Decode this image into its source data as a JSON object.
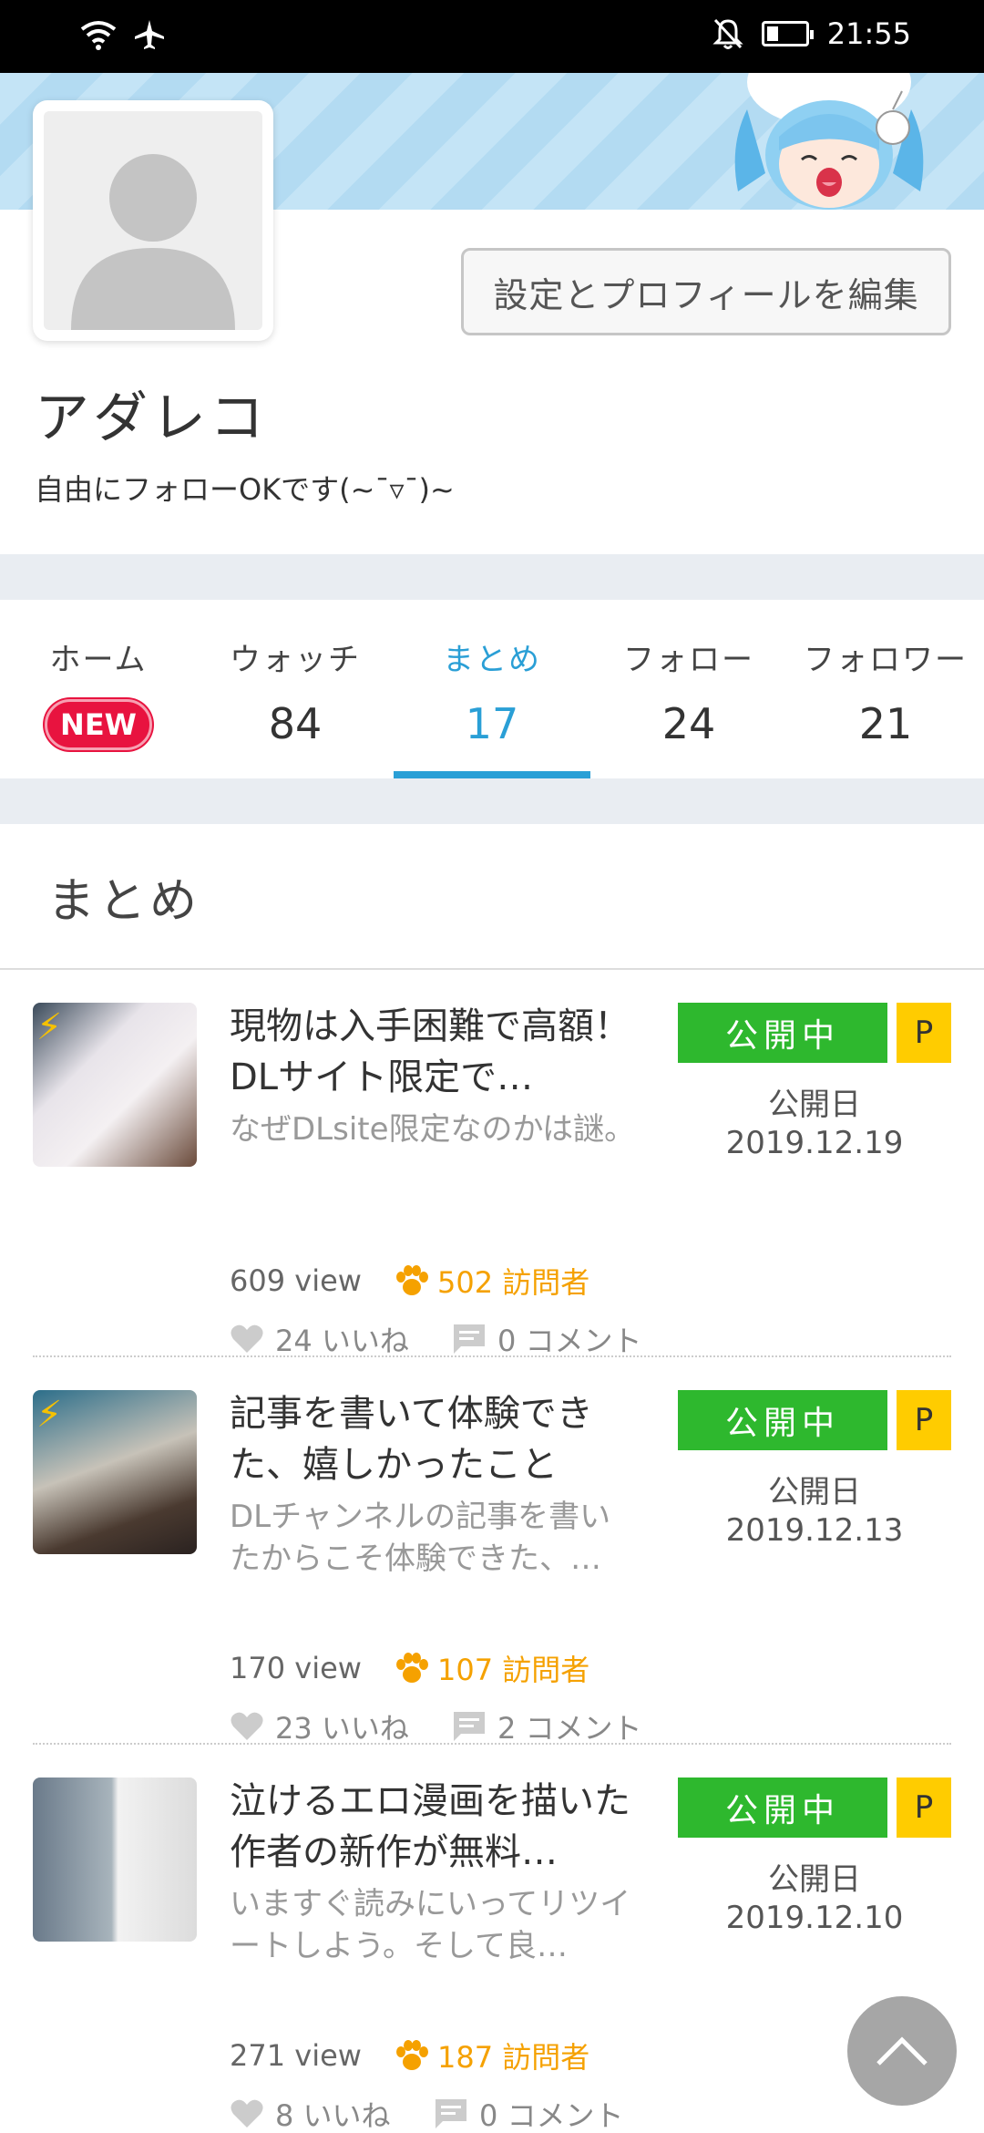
{
  "status_bar": {
    "time": "21:55"
  },
  "profile": {
    "edit_button": "設定とプロフィールを編集",
    "username": "アダレコ",
    "bio": "自由にフォローOKです(~¯▿¯)~"
  },
  "tabs": [
    {
      "label": "ホーム",
      "badge": "NEW"
    },
    {
      "label": "ウォッチ",
      "count": "84"
    },
    {
      "label": "まとめ",
      "count": "17"
    },
    {
      "label": "フォロー",
      "count": "24"
    },
    {
      "label": "フォロワー",
      "count": "21"
    }
  ],
  "section": {
    "title": "まとめ"
  },
  "items": [
    {
      "title": "現物は入手困難で高額！DLサイト限定で…",
      "desc": "なぜDLsite限定なのかは謎。",
      "views": "609 view",
      "visitors": "502 訪問者",
      "likes": "24 いいね",
      "comments": "0 コメント",
      "status": "公開中",
      "badge": "P",
      "date_label": "公開日",
      "date": "2019.12.19"
    },
    {
      "title": "記事を書いて体験できた、嬉しかったこと",
      "desc": "DLチャンネルの記事を書いたからこそ体験できた、…",
      "views": "170 view",
      "visitors": "107 訪問者",
      "likes": "23 いいね",
      "comments": "2 コメント",
      "status": "公開中",
      "badge": "P",
      "date_label": "公開日",
      "date": "2019.12.13"
    },
    {
      "title": "泣けるエロ漫画を描いた作者の新作が無料…",
      "desc": "いますぐ読みにいってリツイートしよう。そして良…",
      "views": "271 view",
      "visitors": "187 訪問者",
      "likes": "8 いいね",
      "comments": "0 コメント",
      "status": "公開中",
      "badge": "P",
      "date_label": "公開日",
      "date": "2019.12.10"
    }
  ],
  "colors": {
    "accent": "#2a9fd6",
    "published": "#2eb82e",
    "badge_p": "#ffcc00",
    "new": "#e8133f",
    "visitors": "#f5a100"
  }
}
